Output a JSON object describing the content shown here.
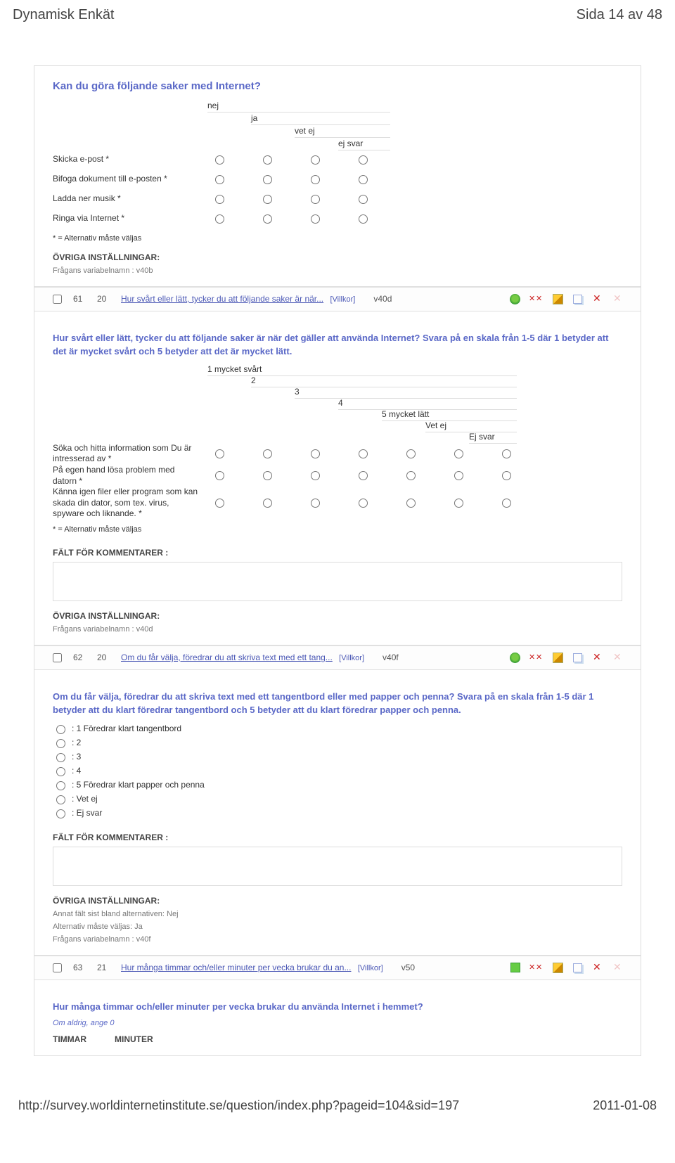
{
  "header": {
    "title": "Dynamisk Enkät",
    "page_label": "Sida 14 av 48"
  },
  "footer": {
    "url": "http://survey.worldinternetinstitute.se/question/index.php?pageid=104&sid=197",
    "date": "2011-01-08"
  },
  "block1": {
    "title": "Kan du göra följande saker med Internet?",
    "cols": [
      "nej",
      "ja",
      "vet ej",
      "ej svar"
    ],
    "rows": [
      "Skicka e-post *",
      "Bifoga dokument till e-posten *",
      "Ladda ner musik *",
      "Ringa via Internet *"
    ],
    "note": "*  = Alternativ måste väljas",
    "settings_head": "ÖVRIGA INSTÄLLNINGAR:",
    "settings_var": "Frågans variabelnamn : v40b"
  },
  "bar1": {
    "n1": "61",
    "n2": "20",
    "link": "Hur svårt eller lätt, tycker du att följande saker är när...",
    "cond": "[Villkor]",
    "code": "v40d"
  },
  "block2": {
    "prompt": "Hur svårt eller lätt, tycker du att följande saker är när det gäller att använda Internet? Svara på en skala från 1-5 där 1 betyder att det är mycket svårt och 5 betyder att det är mycket lätt.",
    "cols": [
      "1 mycket svårt",
      "2",
      "3",
      "4",
      "5 mycket lätt",
      "Vet ej",
      "Ej svar"
    ],
    "rows": [
      "Söka och hitta information som Du är intresserad av  *",
      "På egen hand lösa problem med datorn   *",
      "Känna igen filer eller program som kan skada din dator, som tex. virus, spyware och liknande.  *"
    ],
    "note": "*  = Alternativ måste väljas",
    "comment_head": "FÄLT FÖR KOMMENTARER :",
    "settings_head": "ÖVRIGA INSTÄLLNINGAR:",
    "settings_var": "Frågans variabelnamn : v40d"
  },
  "bar2": {
    "n1": "62",
    "n2": "20",
    "link": "Om du får välja, föredrar du att skriva text med ett tang...",
    "cond": "[Villkor]",
    "code": "v40f"
  },
  "block3": {
    "prompt": "Om du får välja, föredrar du att skriva text med ett tangentbord eller med papper och penna? Svara på en skala från 1-5 där 1 betyder att du klart föredrar tangentbord och 5 betyder att du klart föredrar papper och penna.",
    "options": [
      ": 1 Föredrar klart tangentbord",
      ": 2",
      ": 3",
      ": 4",
      ": 5 Föredrar klart papper och penna",
      ": Vet ej",
      ": Ej svar"
    ],
    "comment_head": "FÄLT FÖR KOMMENTARER :",
    "settings_head": "ÖVRIGA INSTÄLLNINGAR:",
    "settings_1": "Annat fält sist bland alternativen: Nej",
    "settings_2": "Alternativ måste väljas: Ja",
    "settings_3": "Frågans variabelnamn : v40f"
  },
  "bar3": {
    "n1": "63",
    "n2": "21",
    "link": "Hur många timmar och/eller minuter per vecka brukar du an...",
    "cond": "[Villkor]",
    "code": "v50"
  },
  "block4": {
    "prompt": "Hur många timmar och/eller minuter per vecka brukar du använda Internet i hemmet?",
    "sub": "Om aldrig, ange 0",
    "col_a": "TIMMAR",
    "col_b": "MINUTER"
  }
}
